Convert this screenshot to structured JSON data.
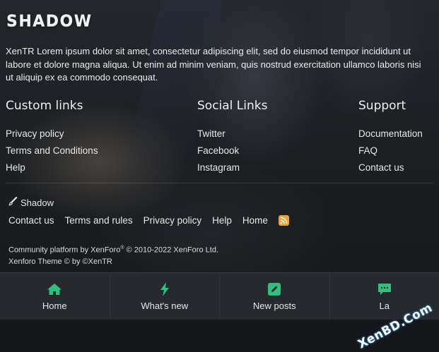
{
  "logo": {
    "text": "SHADOW"
  },
  "about": {
    "text": "XenTR Lorem ipsum dolor sit amet, consectetur adipiscing elit, sed do eiusmod tempor incididunt ut labore et dolore magna aliqua. Ut enim ad minim veniam, quis nostrud exercitation ullamco laboris nisi ut aliquip ex ea commodo consequat."
  },
  "columns": {
    "custom": {
      "title": "Custom links",
      "links": [
        "Privacy policy",
        "Terms and Conditions",
        "Help"
      ]
    },
    "social": {
      "title": "Social Links",
      "links": [
        "Twitter",
        "Facebook",
        "Instagram"
      ]
    },
    "support": {
      "title": "Support",
      "links": [
        "Documentation",
        "FAQ",
        "Contact us"
      ]
    }
  },
  "style_chooser": {
    "icon": "paint-brush-icon",
    "label": "Shadow"
  },
  "footer_links": [
    "Contact us",
    "Terms and rules",
    "Privacy policy",
    "Help",
    "Home"
  ],
  "rss": {
    "icon": "rss-icon",
    "color": "#f0a030"
  },
  "copyright": {
    "line1_prefix": "Community platform by XenForo",
    "registered": "®",
    "line1_suffix": " © 2010-2022 XenForo Ltd.",
    "line2": "Xenforo Theme © by ©XenTR"
  },
  "bottom_nav": {
    "accent": "#2fbf7f",
    "items": [
      {
        "label": "Home",
        "icon": "home-icon"
      },
      {
        "label": "What's new",
        "icon": "bolt-icon"
      },
      {
        "label": "New posts",
        "icon": "edit-icon"
      },
      {
        "label": "La",
        "icon": "comments-icon"
      }
    ]
  },
  "watermark": {
    "text": "XenBD.Com"
  }
}
